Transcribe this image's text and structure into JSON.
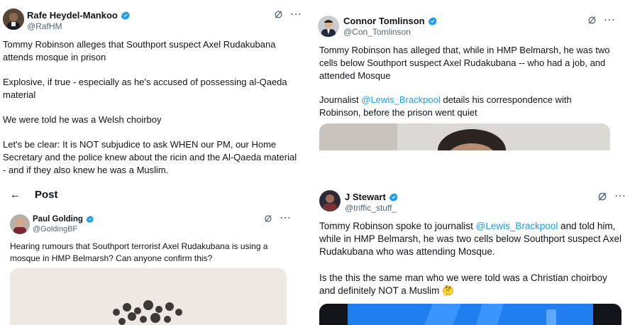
{
  "tweets": [
    {
      "name": "Rafe Heydel-Mankoo",
      "handle": "@RafHM",
      "paragraphs": [
        "Tommy Robinson alleges that Southport suspect Axel Rudakubana attends mosque in prison",
        "Explosive, if true - especially as he's accused of possessing al-Qaeda material",
        "We were told he was a Welsh choirboy",
        "Let's be clear: It is NOT subjudice to ask WHEN our PM, our Home Secretary and the police knew about the ricin and the Al-Qaeda material - and if they also knew he was a Muslim."
      ]
    },
    {
      "name": "Connor Tomlinson",
      "handle": "@Con_Tomlinson",
      "paragraphs": [
        "Tommy Robinson has alleged that, while in HMP Belmarsh, he was two cells below Southport suspect Axel Rudakubana -- who had a job, and attended Mosque"
      ],
      "p2": {
        "pre": "Journalist ",
        "mention": "@Lewis_Brackpool",
        "post": " details his correspondence with Robinson, before the prison went quiet"
      }
    },
    {
      "header_title": "Post",
      "name": "Paul Golding",
      "handle": "@GoldingBF",
      "paragraphs": [
        "Hearing rumours that Southport terrorist Axel Rudakubana is using a mosque in HMP Belmarsh? Can anyone confirm this?"
      ]
    },
    {
      "name": "J Stewart",
      "handle": "@triffic_stuff_",
      "p1": {
        "pre": "Tommy Robinson spoke to journalist ",
        "mention": "@Lewis_Brackpool",
        "post": " and told him, while in HMP Belmarsh, he was two cells below Southport suspect Axel Rudakubana who was attending Mosque."
      },
      "p2": "Is the this the same man who we were told was a Christian choirboy and definitely NOT a Muslim 🤔"
    }
  ],
  "icons": {
    "more": "⋯",
    "back": "←",
    "grok": "grok-icon",
    "verified": "verified-badge-icon"
  },
  "colors": {
    "verified": "#1d9bf0",
    "mention": "#1d9bf0",
    "secondary_text": "#536471"
  }
}
